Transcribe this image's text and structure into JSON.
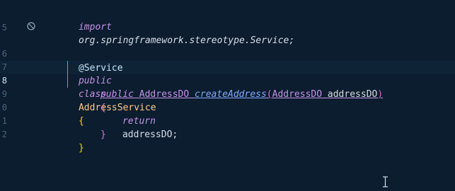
{
  "editor": {
    "lines": [
      {
        "number": "",
        "top_partial": true
      },
      {
        "number": "5"
      },
      {
        "number": "6"
      },
      {
        "number": "7"
      },
      {
        "number": "8",
        "current": true
      },
      {
        "number": "9"
      },
      {
        "number": "0"
      },
      {
        "number": "1"
      },
      {
        "number": "2"
      }
    ],
    "import_line": {
      "keyword": "import",
      "path": "org.springframework.stereotype.Service;"
    },
    "annotation": "@Service",
    "class_decl": {
      "modifier": "public",
      "keyword": "class",
      "name": "AddressService",
      "brace": "{"
    },
    "method_decl": {
      "modifier": "public",
      "return_type": "AddressDO",
      "method_name": "createAddress",
      "open_paren": "(",
      "param_type": "AddressDO",
      "param_name": "addressDO",
      "close_paren": ")",
      "brace": "{"
    },
    "return_stmt": {
      "keyword": "return",
      "value": "addressDO;"
    },
    "method_close": "}",
    "class_close": "}",
    "colors": {
      "background": "#0b1d2e",
      "current_line": "#0e2436",
      "keyword": "#c792ea",
      "class_name": "#ffcb8b",
      "method_name": "#82aaff"
    }
  }
}
